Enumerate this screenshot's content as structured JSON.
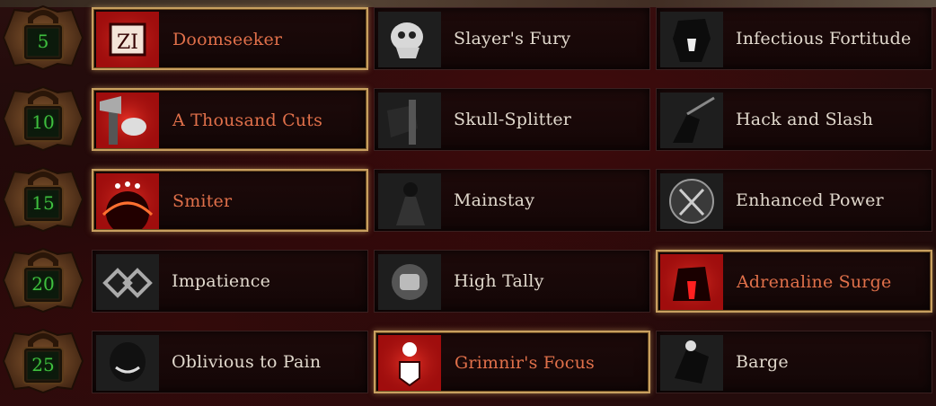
{
  "colors": {
    "selected_text": "#e0704a",
    "normal_text": "#e0d8cc",
    "level_text": "#3fbf3f",
    "selected_border": "#c8a060"
  },
  "rows": [
    {
      "level": "5",
      "talents": [
        {
          "name": "Doomseeker",
          "selected": true,
          "icon": "doomseeker-rune-icon"
        },
        {
          "name": "Slayer's Fury",
          "selected": false,
          "icon": "skull-icon"
        },
        {
          "name": "Infectious Fortitude",
          "selected": false,
          "icon": "roaring-slayer-icon"
        }
      ]
    },
    {
      "level": "10",
      "talents": [
        {
          "name": "A Thousand Cuts",
          "selected": true,
          "icon": "axe-fist-icon"
        },
        {
          "name": "Skull-Splitter",
          "selected": false,
          "icon": "axe-grip-icon"
        },
        {
          "name": "Hack and Slash",
          "selected": false,
          "icon": "slashing-figure-icon"
        }
      ]
    },
    {
      "level": "15",
      "talents": [
        {
          "name": "Smiter",
          "selected": true,
          "icon": "eclipse-eyes-icon"
        },
        {
          "name": "Mainstay",
          "selected": false,
          "icon": "chained-figure-icon"
        },
        {
          "name": "Enhanced Power",
          "selected": false,
          "icon": "crossed-axes-icon"
        }
      ]
    },
    {
      "level": "20",
      "talents": [
        {
          "name": "Impatience",
          "selected": false,
          "icon": "double-diamond-icon"
        },
        {
          "name": "High Tally",
          "selected": false,
          "icon": "clenched-fist-icon"
        },
        {
          "name": "Adrenaline Surge",
          "selected": true,
          "icon": "howling-beast-icon"
        }
      ]
    },
    {
      "level": "25",
      "talents": [
        {
          "name": "Oblivious to Pain",
          "selected": false,
          "icon": "grinning-face-icon"
        },
        {
          "name": "Grimnir's Focus",
          "selected": true,
          "icon": "dwarf-shield-icon"
        },
        {
          "name": "Barge",
          "selected": false,
          "icon": "charging-dwarf-icon"
        }
      ]
    }
  ]
}
